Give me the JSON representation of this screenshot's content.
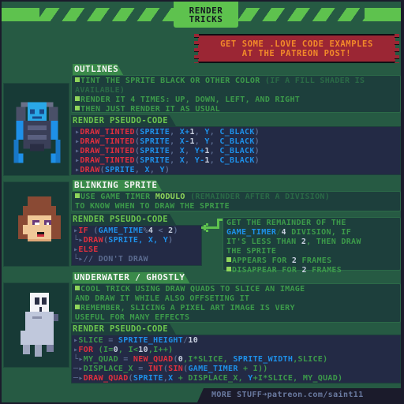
{
  "header": {
    "title_line1": "Render",
    "title_line2": "Tricks"
  },
  "promo": {
    "line1": "Get some .love code examples",
    "line2": "at the Patreon post!"
  },
  "sections": {
    "outlines": {
      "title": "Outlines",
      "bullets": [
        {
          "main": "Tint the sprite black or other color",
          "dim": " (if a fill shader is available)"
        },
        {
          "main": "Render it 4 times: up, down, left, and right"
        },
        {
          "main": "Then just render it as usual"
        }
      ],
      "code_title": "Render pseudo-code",
      "code": [
        {
          "fn": "DRAW_TINTED",
          "args": [
            "SPRITE",
            "X+1",
            "Y",
            "C_BLACK"
          ]
        },
        {
          "fn": "DRAW_TINTED",
          "args": [
            "SPRITE",
            "X-1",
            "Y",
            "C_BLACK"
          ]
        },
        {
          "fn": "DRAW_TINTED",
          "args": [
            "SPRITE",
            "X",
            "Y+1",
            "C_BLACK"
          ]
        },
        {
          "fn": "DRAW_TINTED",
          "args": [
            "SPRITE",
            "X",
            "Y-1",
            "C_BLACK"
          ]
        },
        {
          "fn": "DRAW",
          "args": [
            "SPRITE",
            "X",
            "Y"
          ]
        }
      ]
    },
    "blinking": {
      "title": "Blinking sprite",
      "bullet_prefix": "Use game timer ",
      "bullet_highlight": "modulo",
      "bullet_dim": " (remainder after a division)",
      "bullet_line2": "to know when to draw the sprite",
      "code_title": "Render pseudo-code",
      "code_lines": {
        "if_kw": "IF",
        "if_var": "GAME_TIME",
        "if_op": "%",
        "if_mod": "4",
        "if_lt": "<",
        "if_val": "2",
        "draw_fn": "DRAW",
        "draw_args": "SPRITE, X, Y",
        "else_kw": "ELSE",
        "comment": "// DON'T DRAW"
      },
      "explain": {
        "line1": "Get the remainder of the",
        "var": "GAME_TIMER",
        "op": "/",
        "mod": "4",
        "line2_rest": " division, if",
        "line3a": "it's less than ",
        "line3num": "2",
        "line3b": ", then draw",
        "line4": "the sprite",
        "bullets": [
          {
            "pre": "Appears for ",
            "num": "2",
            "post": " frames"
          },
          {
            "pre": "Disappear for ",
            "num": "2",
            "post": " frames"
          }
        ]
      }
    },
    "underwater": {
      "title": "Underwater / Ghostly",
      "bullets": [
        {
          "line1": "Cool trick using draw quads to slice an image",
          "line2": "and draw it while also offseting it"
        },
        {
          "line1": "Remember, slicing a pixel art image is very",
          "line2": "useful for many effects"
        }
      ],
      "code_title": "Render pseudo-code",
      "code_lines": {
        "l1_var": "SLICE",
        "l1_eq": " = ",
        "l1_id": "SPRITE_HEIGHT",
        "l1_op": "/",
        "l1_num": "10",
        "l2_kw": "FOR",
        "l2_open": " (I=",
        "l2_n0": "0",
        "l2_mid": ", I<",
        "l2_n10": "10",
        "l2_end": ",I++)",
        "l3_var": "MY_QUAD",
        "l3_eq": " = ",
        "l3_fn": "NEW_QUAD",
        "l3_open": "(",
        "l3_n0": "0",
        "l3_a": ",I*SLICE, ",
        "l3_id": "SPRITE_WIDTH",
        "l3_b": ",SLICE)",
        "l4_var": "DISPLACE_X",
        "l4_eq": " = ",
        "l4_fn1": "INT",
        "l4_fn2": "SIN",
        "l4_id": "GAME_TIMER",
        "l4_rest": " + I))",
        "l5_fn": "DRAW_QUAD",
        "l5_id": "SPRITE",
        "l5_x": "X",
        "l5_a": " + DISPLACE_X, ",
        "l5_y": "Y",
        "l5_b": "+I*SLICE, MY_QUAD)"
      }
    }
  },
  "footer": {
    "prefix": "More stuff",
    "arrow": "➜",
    "link": "patreon.com/saint11"
  },
  "colors": {
    "background": "#265a43",
    "accent_green": "#5ec24e",
    "promo_red": "#9b2634",
    "promo_text": "#f28a2a",
    "code_bg": "#232a45",
    "code_red": "#e0303e",
    "code_blue": "#1e90e8"
  }
}
